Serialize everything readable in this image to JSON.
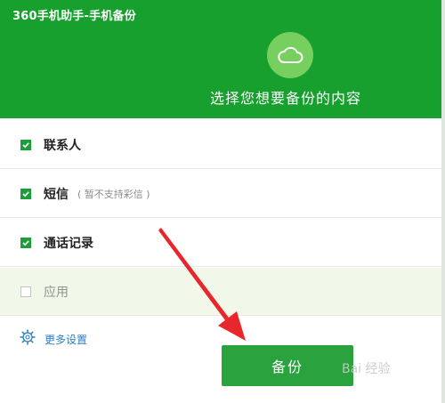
{
  "header": {
    "app_title": "360手机助手-手机备份",
    "subtitle": "选择您想要备份的内容"
  },
  "options": [
    {
      "label": "联系人",
      "checked": true
    },
    {
      "label": "短信",
      "note": "( 暂不支持彩信 )",
      "checked": true
    },
    {
      "label": "通话记录",
      "checked": true
    },
    {
      "label": "应用",
      "checked": false
    }
  ],
  "more_settings": {
    "label": "更多设置"
  },
  "backup_button": {
    "label": "备份"
  },
  "watermark": {
    "text": "Bai 经验"
  },
  "colors": {
    "header_green": "#17a02d",
    "accent_green": "#1b9e3a",
    "link_blue": "#2a7fc1",
    "arrow_red": "#e8262c"
  }
}
